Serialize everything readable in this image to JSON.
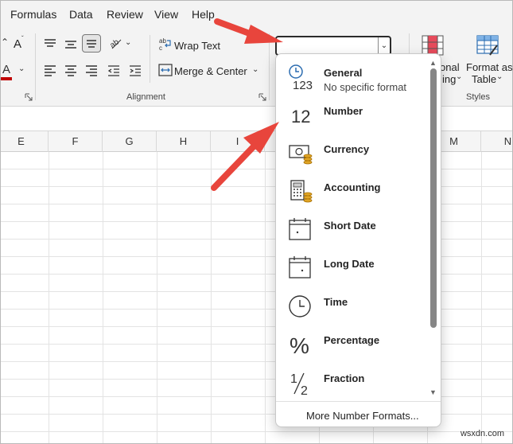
{
  "menu": {
    "tabs": [
      "Formulas",
      "Data",
      "Review",
      "View",
      "Help"
    ]
  },
  "ribbon": {
    "font_color_letter": "A",
    "grow_font_letter": "A",
    "wrap_text_label": "Wrap Text",
    "merge_center_label": "Merge & Center",
    "alignment_group_label": "Alignment",
    "conditional_formatting_label_line1": "onal",
    "conditional_formatting_label_line2": "ing",
    "format_as_table_line1": "Format as",
    "format_as_table_line2": "Table",
    "styles_group_label": "Styles",
    "number_format_value": ""
  },
  "columns": [
    "E",
    "F",
    "G",
    "H",
    "I",
    "M",
    "N"
  ],
  "dropdown": {
    "items": [
      {
        "name": "General",
        "sub": "No specific format",
        "icon": "clock-123-icon"
      },
      {
        "name": "Number",
        "sub": "",
        "icon": "number-12-icon"
      },
      {
        "name": "Currency",
        "sub": "",
        "icon": "currency-icon"
      },
      {
        "name": "Accounting",
        "sub": "",
        "icon": "accounting-icon"
      },
      {
        "name": "Short Date",
        "sub": "",
        "icon": "calendar-icon"
      },
      {
        "name": "Long Date",
        "sub": "",
        "icon": "calendar-icon"
      },
      {
        "name": "Time",
        "sub": "",
        "icon": "clock-icon"
      },
      {
        "name": "Percentage",
        "sub": "",
        "icon": "percent-icon"
      },
      {
        "name": "Fraction",
        "sub": "",
        "icon": "fraction-icon"
      }
    ],
    "more_label": "More Number Formats...",
    "general_icon_text": "123",
    "number_icon_text": "12",
    "percent_icon_text": "%"
  },
  "annotation": {
    "arrow_color": "#e8453c"
  },
  "watermark": "wsxdn.com"
}
